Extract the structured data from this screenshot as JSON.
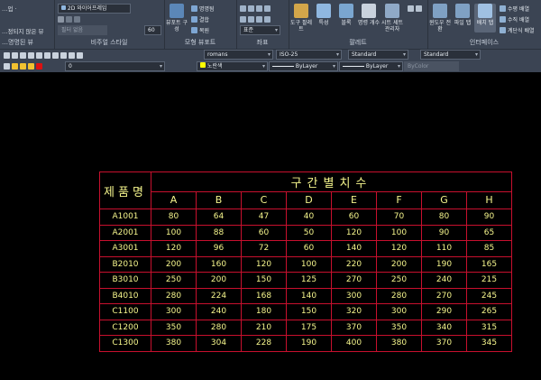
{
  "ribbon": {
    "workspace_label": "…업 ·",
    "visual_style_value": "2D 와이어프레임",
    "filter_field": "필터 없음",
    "unsaved_label": "…정되지 않은 뷰",
    "visual_style_caption": "비주얼 스타일",
    "model_viewport_caption": "모형 뷰포트",
    "coordinates_caption": "좌표",
    "palette_caption": "팔레트",
    "interface_caption": "인터페이스",
    "unnamed_view_caption": "…명명된 뷰",
    "viewport_config_label": "뷰포트 구성",
    "named_label": "명명됨",
    "join_label": "결합",
    "restore_label": "복원",
    "tool_palette_label": "도구 팔레트",
    "properties_label": "특성",
    "block_label": "블록",
    "sheet_set_label": "시트 세트 관리자",
    "command_label": "명령 개수",
    "ucs_value": "표준",
    "window_switch_label": "윈도우 전환",
    "file_tab_label": "파일 탭",
    "layout_tab_label": "배치 탭",
    "horizontal_tile_label": "수평 배열",
    "vertical_tile_label": "수직 배열",
    "cascade_label": "계단식 배열",
    "zoom_value": "60"
  },
  "bar1": {
    "text_style": "romans",
    "dim_style": "ISO-25",
    "table_style": "Standard",
    "mleader_style": "Standard"
  },
  "bar2": {
    "layer_name": "0",
    "color_name": "노란색",
    "linetype": "ByLayer",
    "lineweight": "ByLayer",
    "plot_style": "ByColor"
  },
  "table": {
    "name_header": "제품명",
    "title": "구간별치수",
    "columns": [
      "A",
      "B",
      "C",
      "D",
      "E",
      "F",
      "G",
      "H"
    ],
    "rows": [
      {
        "name": "A1001",
        "values": [
          80,
          64,
          47,
          40,
          60,
          70,
          80,
          90
        ]
      },
      {
        "name": "A2001",
        "values": [
          100,
          88,
          60,
          50,
          120,
          100,
          90,
          65
        ]
      },
      {
        "name": "A3001",
        "values": [
          120,
          96,
          72,
          60,
          140,
          120,
          110,
          85
        ]
      },
      {
        "name": "B2010",
        "values": [
          200,
          160,
          120,
          100,
          220,
          200,
          190,
          165
        ]
      },
      {
        "name": "B3010",
        "values": [
          250,
          200,
          150,
          125,
          270,
          250,
          240,
          215
        ]
      },
      {
        "name": "B4010",
        "values": [
          280,
          224,
          168,
          140,
          300,
          280,
          270,
          245
        ]
      },
      {
        "name": "C1100",
        "values": [
          300,
          240,
          180,
          150,
          320,
          300,
          290,
          265
        ]
      },
      {
        "name": "C1200",
        "values": [
          350,
          280,
          210,
          175,
          370,
          350,
          340,
          315
        ]
      },
      {
        "name": "C1300",
        "values": [
          380,
          304,
          228,
          190,
          400,
          380,
          370,
          345
        ]
      }
    ]
  },
  "colors": {
    "ribbon_bg": "#3b4453",
    "canvas_bg": "#000000",
    "table_border": "#c8102e",
    "table_text": "#f5f58c"
  }
}
